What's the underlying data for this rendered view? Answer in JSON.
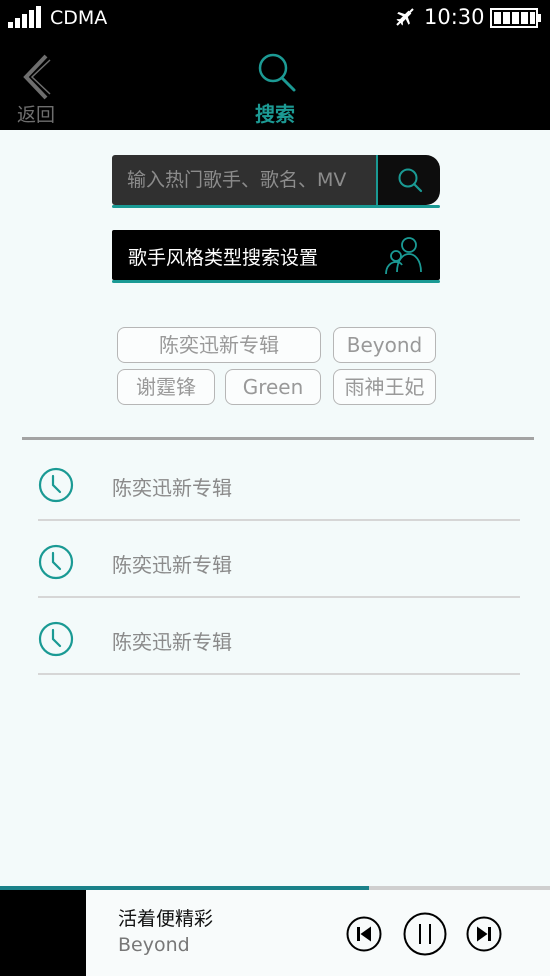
{
  "status_bar": {
    "carrier": "CDMA",
    "time": "10:30"
  },
  "nav": {
    "back_label": "返回",
    "title": "搜索"
  },
  "search": {
    "placeholder": "输入热门歌手、歌名、MV"
  },
  "style_settings": {
    "label": "歌手风格类型搜索设置"
  },
  "hot_tags": [
    "陈奕迅新专辑",
    "Beyond",
    "谢霆锋",
    "Green",
    "雨神王妃"
  ],
  "history": [
    {
      "label": "陈奕迅新专辑"
    },
    {
      "label": "陈奕迅新专辑"
    },
    {
      "label": "陈奕迅新专辑"
    }
  ],
  "player": {
    "song_title": "活着便精彩",
    "artist": "Beyond",
    "progress": 0.67
  },
  "colors": {
    "accent": "#1a9a94",
    "bar_background": "#000000",
    "page_background": "#f3fafa"
  },
  "icons": {
    "signal": "signal-bars-icon",
    "airplane": "airplane-mode-icon",
    "battery": "battery-full-icon",
    "back": "chevron-left-icon",
    "search": "search-icon",
    "style": "singer-people-icon",
    "history": "clock-icon",
    "prev": "previous-track-icon",
    "pause": "pause-icon",
    "next": "next-track-icon"
  }
}
